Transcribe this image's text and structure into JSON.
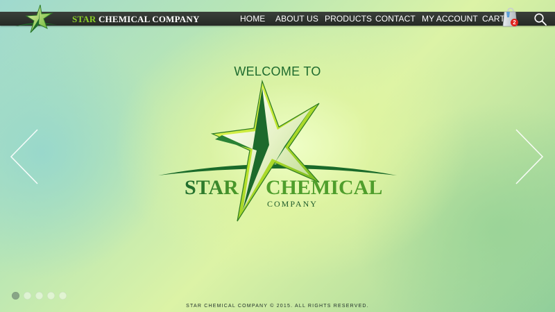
{
  "header": {
    "brand": {
      "word1": "STAR",
      "word2": "CHEMICAL COMPANY"
    },
    "nav": [
      {
        "label": "HOME"
      },
      {
        "label": "ABOUT US"
      },
      {
        "label": "PRODUCTS"
      },
      {
        "label": "CONTACT"
      },
      {
        "label": "MY ACCOUNT"
      },
      {
        "label": "CART"
      }
    ],
    "cart_count": "2",
    "icons": {
      "cart": "shopping-bag-icon",
      "search": "search-icon"
    }
  },
  "hero": {
    "welcome": "WELCOME TO",
    "logo": {
      "word1": "STAR",
      "word2": "CHEMICAL",
      "sub": "COMPANY"
    },
    "slides": {
      "count": 5,
      "active": 1
    }
  },
  "footer": {
    "text": "STAR CHEMICAL COMPANY © 2015. ALL RIGHTS RESERVED."
  },
  "colors": {
    "brand_green": "#8bd02a",
    "dark_green": "#1e6b2e",
    "nav_bar": "#2e332e",
    "badge_red": "#e0211b"
  }
}
